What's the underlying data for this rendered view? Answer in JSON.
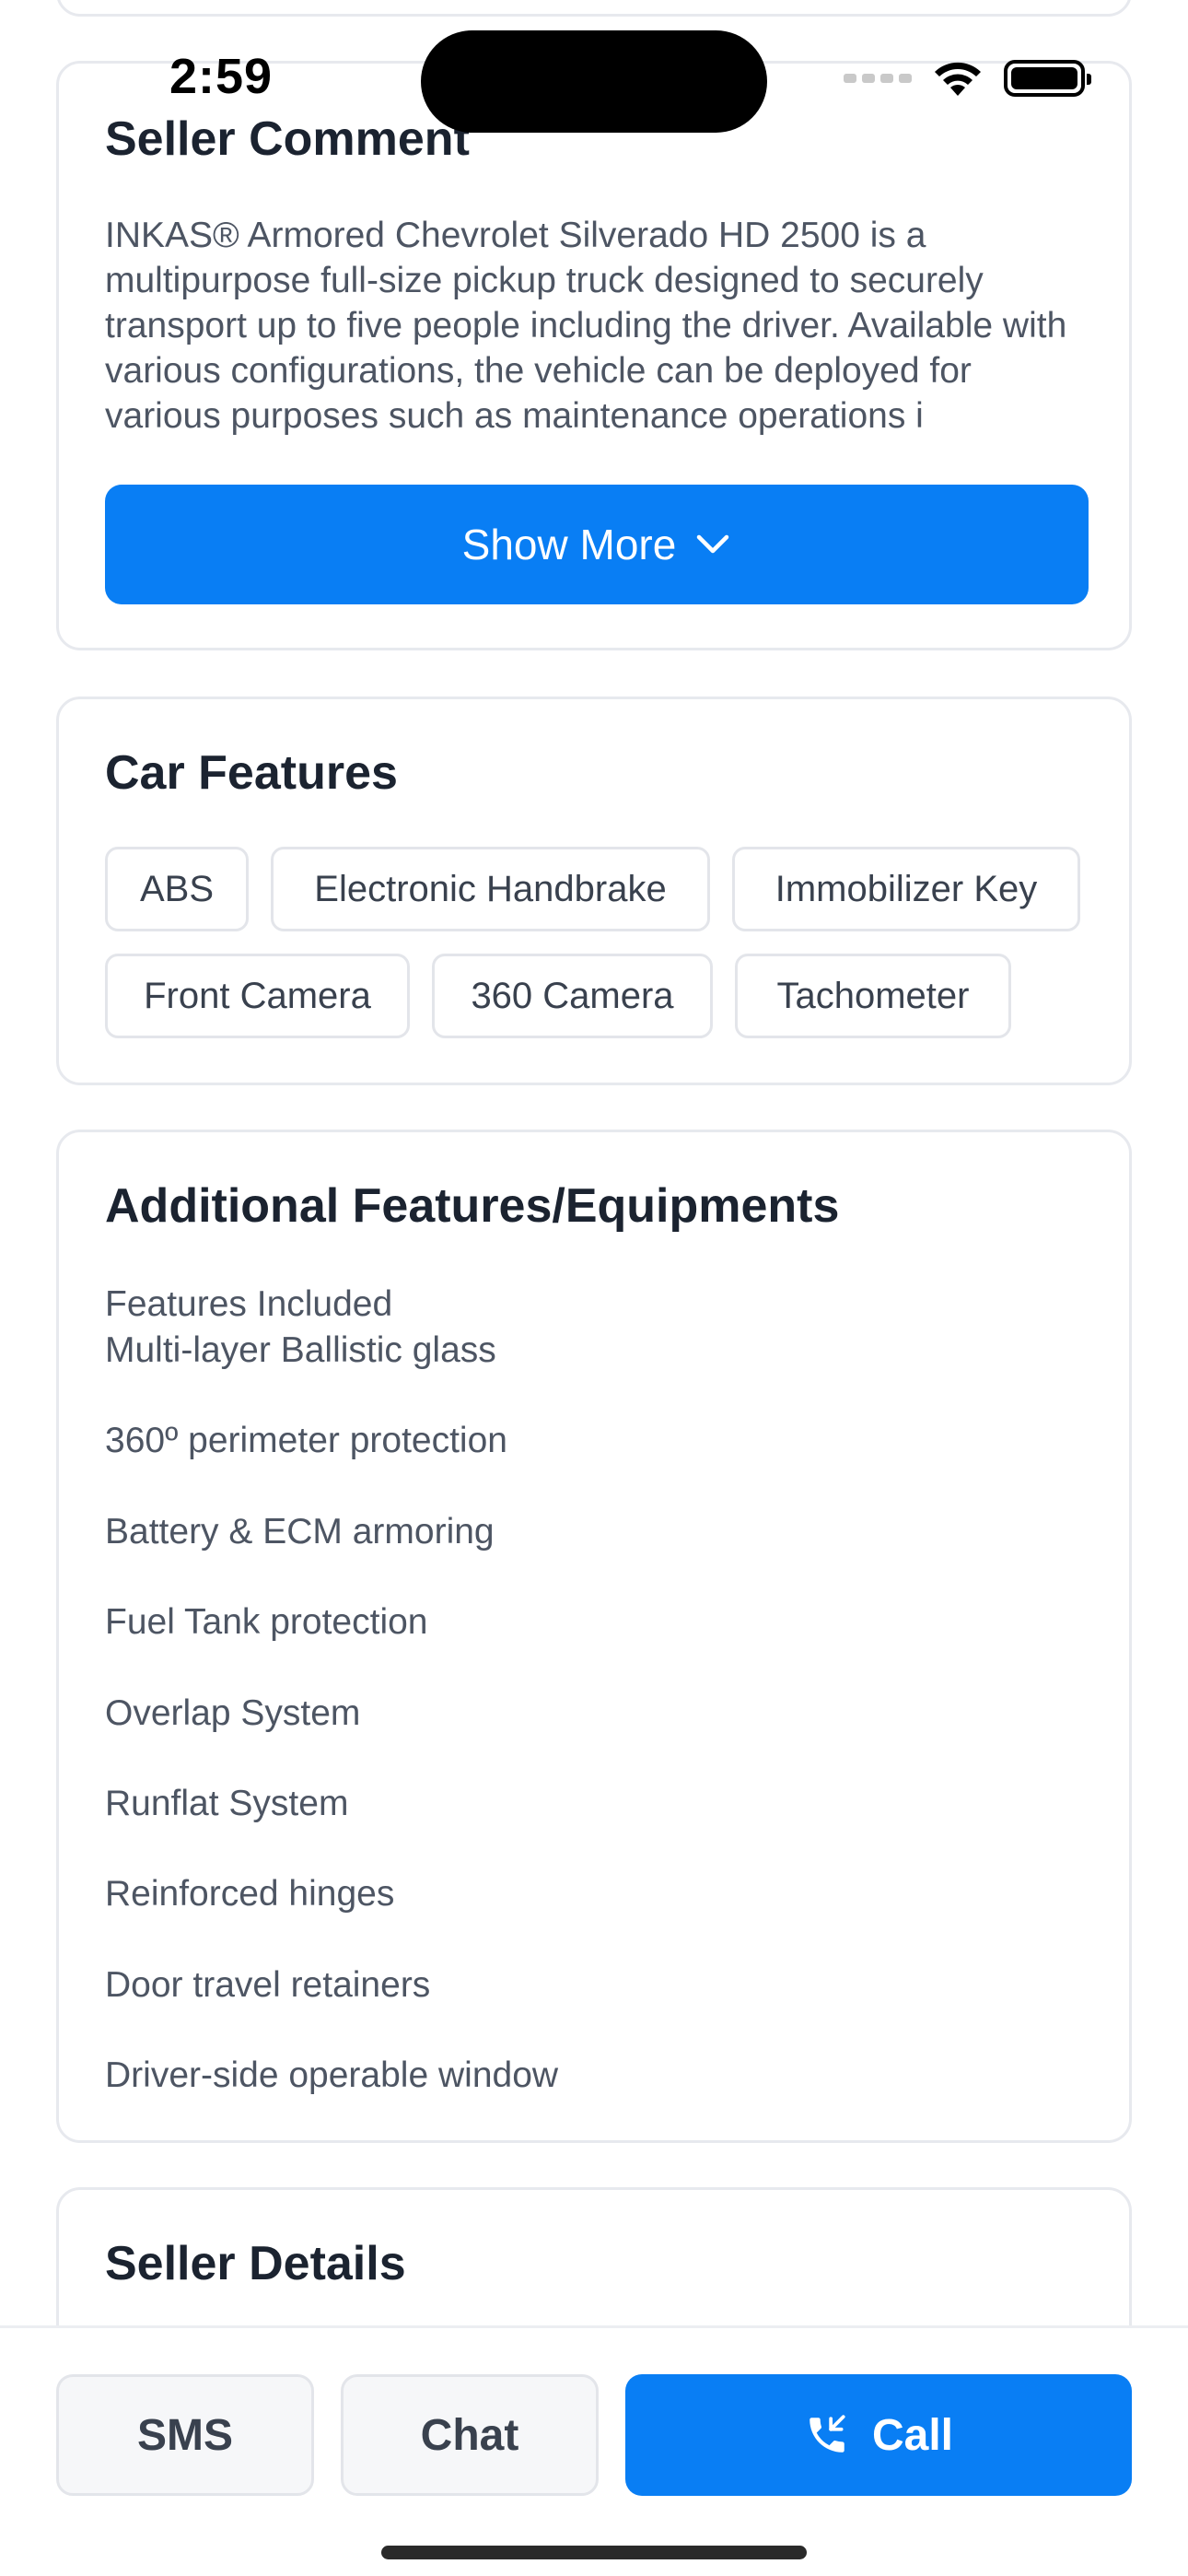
{
  "status_bar": {
    "time": "2:59",
    "icons": [
      "signal-dots-icon",
      "wifi-icon",
      "battery-icon"
    ]
  },
  "seller_comment": {
    "title": "Seller Comment",
    "text": "INKAS® Armored Chevrolet Silverado HD 2500 is a multipurpose full-size pickup truck designed to securely transport up to five people including the driver. Available with various configurations, the vehicle can be deployed for various purposes such as maintenance operations i",
    "show_more_label": "Show More",
    "show_more_icon": "chevron-down-icon"
  },
  "car_features": {
    "title": "Car Features",
    "chips": [
      "ABS",
      "Electronic Handbrake",
      "Immobilizer Key",
      "Front Camera",
      "360 Camera",
      "Tachometer"
    ]
  },
  "additional_features": {
    "title": "Additional Features/Equipments",
    "items": [
      "Features Included",
      "Multi-layer Ballistic glass",
      "360º perimeter protection",
      "Battery & ECM armoring",
      "Fuel Tank protection",
      "Overlap System",
      "Runflat System",
      "Reinforced hinges",
      "Door travel retainers",
      "Driver-side operable window"
    ]
  },
  "seller_details": {
    "title": "Seller Details"
  },
  "bottom_bar": {
    "sms_label": "SMS",
    "chat_label": "Chat",
    "call_label": "Call",
    "call_icon": "phone-call-icon"
  },
  "colors": {
    "accent": "#097ef4",
    "heading": "#1b2330",
    "body_text": "#4d5563",
    "border": "#e7e9ee"
  }
}
